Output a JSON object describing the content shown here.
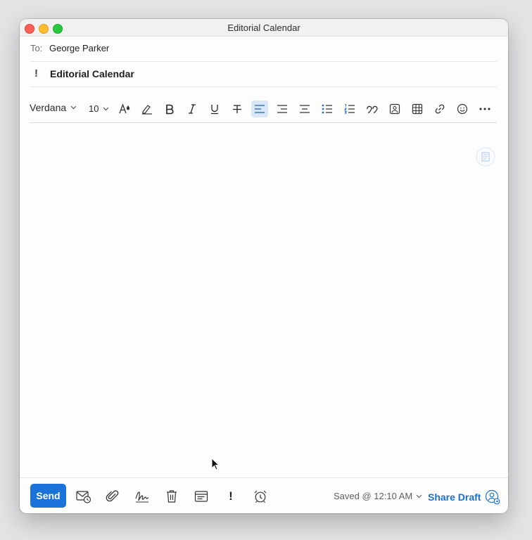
{
  "window": {
    "title": "Editorial Calendar"
  },
  "header": {
    "to_label": "To:",
    "to_value": "George Parker",
    "importance_mark": "!",
    "subject": "Editorial Calendar"
  },
  "toolbar": {
    "font_family": "Verdana",
    "font_size": "10",
    "buttons": [
      "text-color",
      "highlight",
      "bold",
      "italic",
      "underline",
      "strikethrough",
      "align-left",
      "align-right",
      "align-center",
      "bulleted-list",
      "numbered-list",
      "quote",
      "insert-picture",
      "insert-table",
      "insert-link",
      "emoji",
      "more"
    ],
    "active_button": "align-left"
  },
  "footer": {
    "send_label": "Send",
    "importance_label": "!",
    "saved_status": "Saved @ 12:10 AM",
    "share_label": "Share Draft"
  },
  "colors": {
    "accent": "#1a73d9",
    "link": "#1a6fd1",
    "active_bg": "#d8e6f8"
  }
}
